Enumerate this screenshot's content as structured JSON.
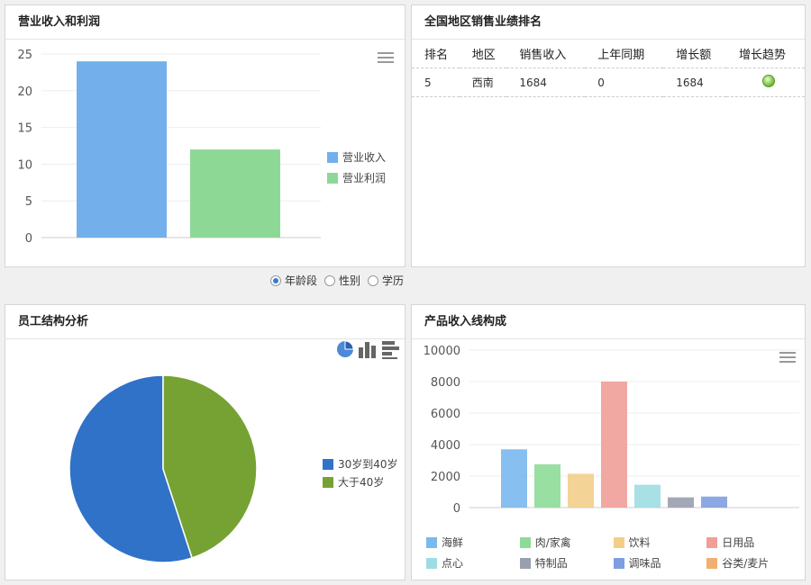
{
  "panels": {
    "revenue": {
      "title": "营业收入和利润"
    },
    "ranking": {
      "title": "全国地区销售业绩排名"
    },
    "staff": {
      "title": "员工结构分析"
    },
    "product": {
      "title": "产品收入线构成"
    }
  },
  "ranking_table": {
    "headers": [
      "排名",
      "地区",
      "销售收入",
      "上年同期",
      "增长额",
      "增长趋势"
    ],
    "rows": [
      [
        "5",
        "西南",
        "1684",
        "0",
        "1684",
        "up"
      ]
    ]
  },
  "filter": {
    "options": [
      "年龄段",
      "性别",
      "学历"
    ],
    "selected": "年龄段"
  },
  "colors": {
    "blue": "#72afeb",
    "green": "#8ed896",
    "pie_blue": "#2f72c8",
    "pie_green": "#76a233"
  },
  "chart_data": [
    {
      "type": "bar",
      "categories": [
        "营业收入",
        "营业利润"
      ],
      "values": [
        24,
        12
      ],
      "colors": [
        "#72afeb",
        "#8ed896"
      ],
      "ylim": [
        0,
        25
      ],
      "yticks": [
        0,
        5,
        10,
        15,
        20,
        25
      ],
      "legend": [
        "营业收入",
        "营业利润"
      ],
      "legend_position": "right"
    },
    {
      "type": "pie",
      "labels": [
        "30岁到40岁",
        "大于40岁"
      ],
      "values": [
        55,
        45
      ],
      "colors": [
        "#2f72c8",
        "#76a233"
      ],
      "legend_position": "right"
    },
    {
      "type": "bar",
      "categories": [
        "海鲜",
        "肉/家禽",
        "饮料",
        "日用品",
        "点心",
        "特制品",
        "调味品",
        "谷类/麦片"
      ],
      "values": [
        3700,
        2750,
        2150,
        8000,
        1450,
        650,
        700,
        0
      ],
      "colors": [
        "#7ab8f0",
        "#8edb97",
        "#f3ce8b",
        "#ef9f98",
        "#9ddde2",
        "#9a9fae",
        "#7f9ee0",
        "#f0b072"
      ],
      "ylim": [
        0,
        10000
      ],
      "yticks": [
        0,
        2000,
        4000,
        6000,
        8000,
        10000
      ],
      "legend_position": "bottom"
    }
  ]
}
